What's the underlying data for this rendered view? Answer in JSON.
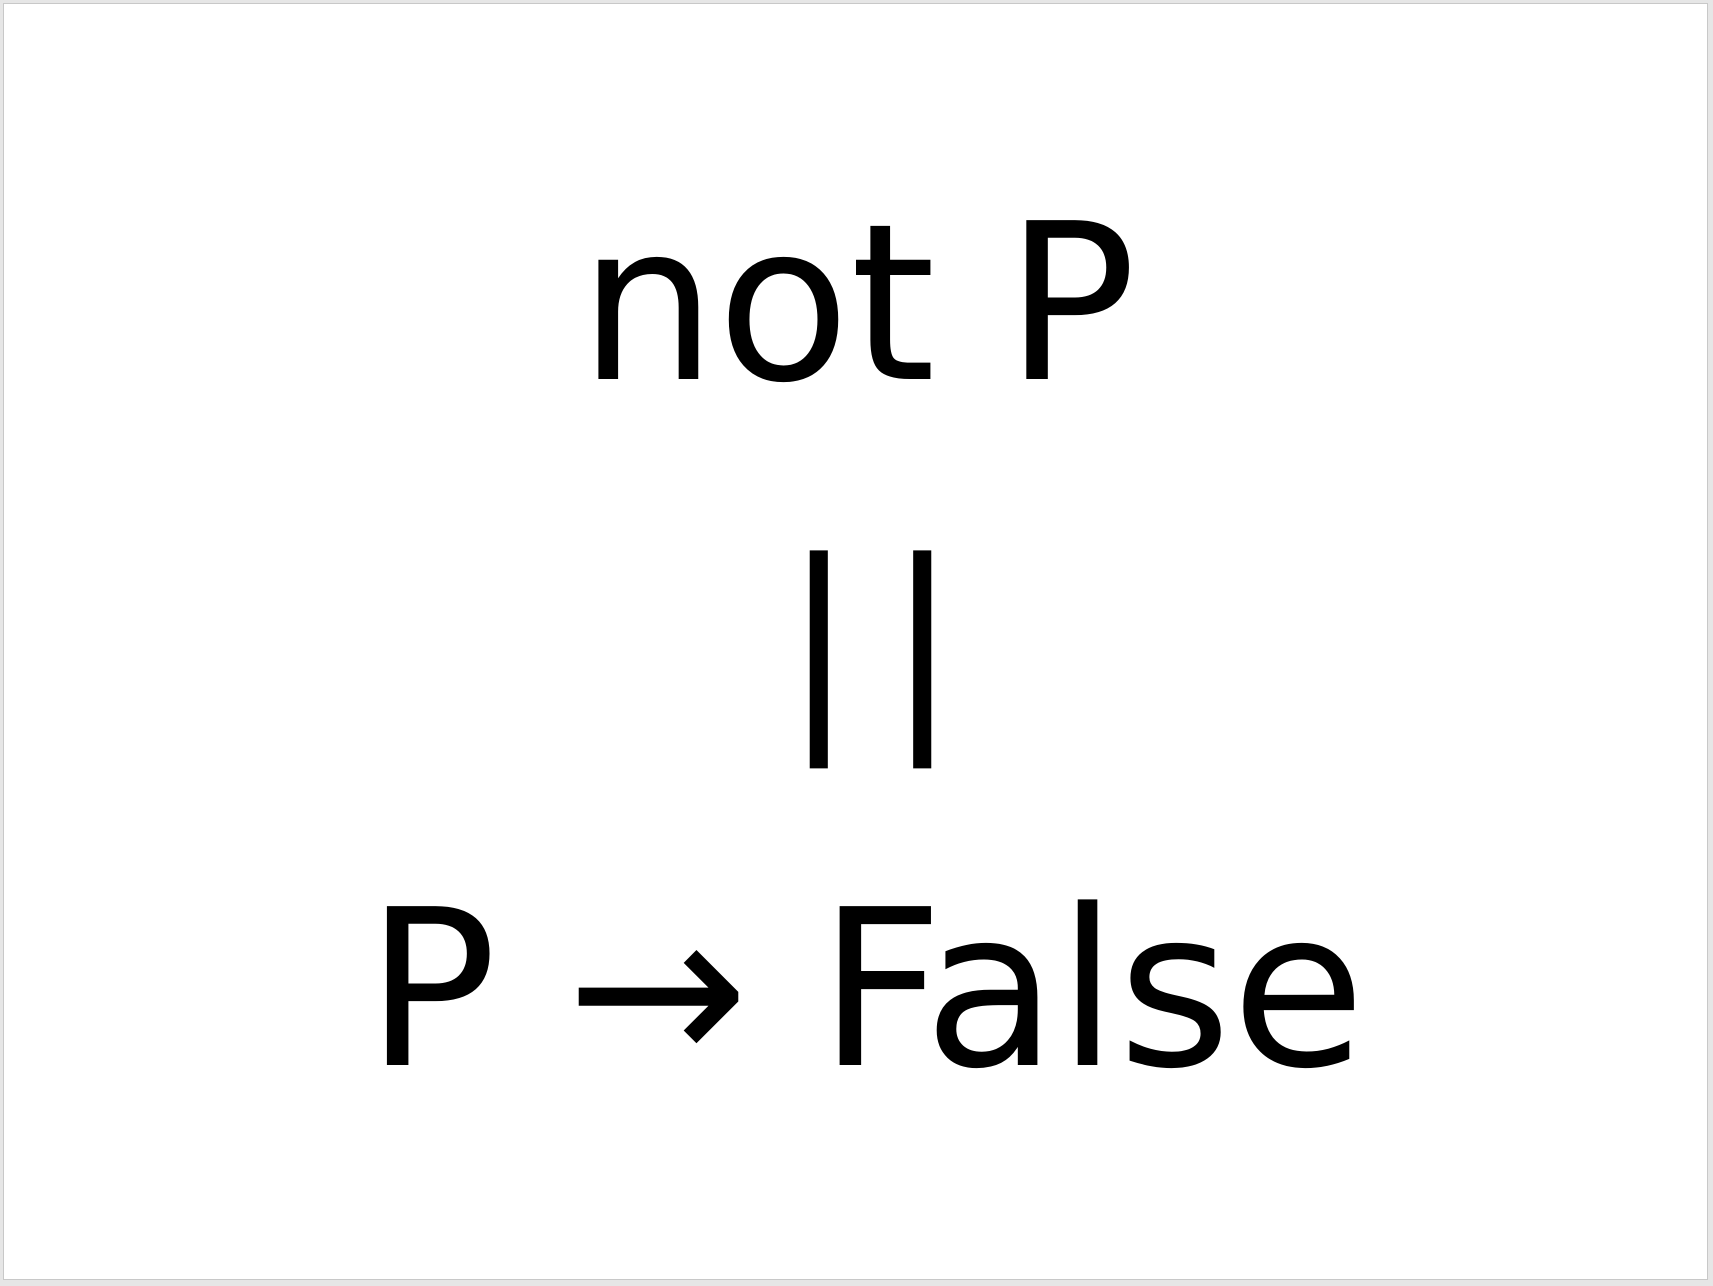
{
  "slide": {
    "line1": "not P",
    "line2": "||",
    "line3": "P → False"
  }
}
